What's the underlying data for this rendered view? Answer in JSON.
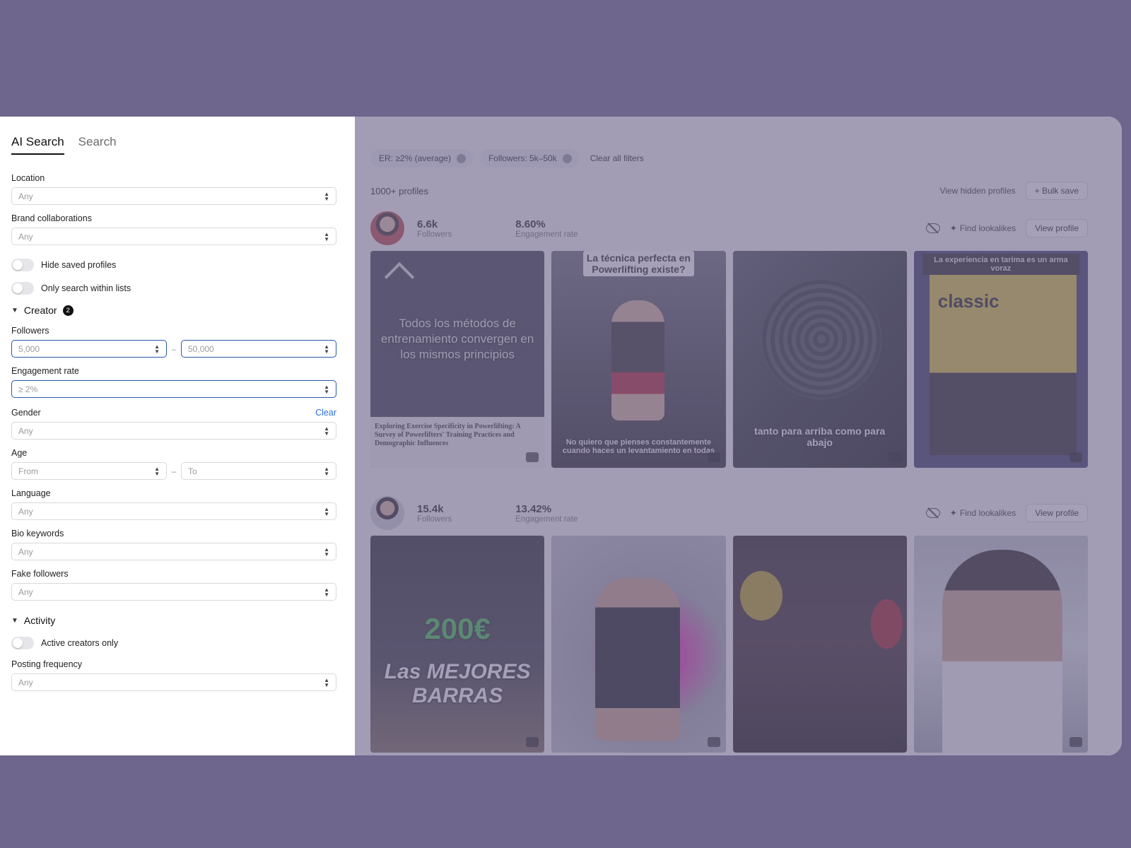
{
  "sidebar": {
    "tabs": [
      "AI Search",
      "Search"
    ],
    "location": {
      "label": "Location",
      "placeholder": "Any"
    },
    "brand": {
      "label": "Brand collaborations",
      "placeholder": "Any"
    },
    "hide_saved": "Hide saved profiles",
    "only_lists": "Only search within lists",
    "creator": {
      "label": "Creator",
      "count": "2"
    },
    "followers": {
      "label": "Followers",
      "from": "5,000",
      "to": "50,000",
      "dash": "–"
    },
    "engagement": {
      "label": "Engagement rate",
      "value": "≥ 2%"
    },
    "gender": {
      "label": "Gender",
      "clear": "Clear",
      "placeholder": "Any"
    },
    "age": {
      "label": "Age",
      "from": "From",
      "to": "To",
      "dash": "–"
    },
    "language": {
      "label": "Language",
      "placeholder": "Any"
    },
    "bio": {
      "label": "Bio keywords",
      "placeholder": "Any"
    },
    "fake": {
      "label": "Fake followers",
      "placeholder": "Any"
    },
    "activity": {
      "label": "Activity"
    },
    "active_only": "Active creators only",
    "posting": {
      "label": "Posting frequency",
      "placeholder": "Any"
    }
  },
  "main": {
    "chips": [
      "ER: ≥2% (average)",
      "Followers: 5k–50k"
    ],
    "clear_all": "Clear all filters",
    "results_count": "1000+ profiles",
    "view_hidden": "View hidden profiles",
    "bulk_save": "+ Bulk save",
    "find_lookalikes": "Find lookalikes",
    "view_profile": "View profile",
    "profiles": [
      {
        "followers": "6.6k",
        "followers_label": "Followers",
        "er": "8.60%",
        "er_label": "Engagement rate",
        "posts": {
          "p1_big": "Todos los métodos de entrenamiento convergen en los mismos principios",
          "p1_paper": "Exploring Exercise Specificity in Powerlifting: A Survey of Powerlifters' Training Practices and Demographic Influences",
          "p2_cap": "La técnica perfecta en Powerlifting existe?",
          "p2_bottom": "No quiero que pienses constantemente cuando haces un levantamiento en todas",
          "p3_bottom": "tanto para arriba como para abajo",
          "p4_cap": "La experiencia en tarima es un arma voraz",
          "p4_word": "classic"
        }
      },
      {
        "followers": "15.4k",
        "followers_label": "Followers",
        "er": "13.42%",
        "er_label": "Engagement rate",
        "posts": {
          "p1_price": "200€",
          "p1_best": "Las MEJORES BARRAS"
        }
      }
    ]
  },
  "colors": {
    "backdrop": "#6e668d",
    "accent": "#2a56a8",
    "link": "#2f6fd6"
  }
}
